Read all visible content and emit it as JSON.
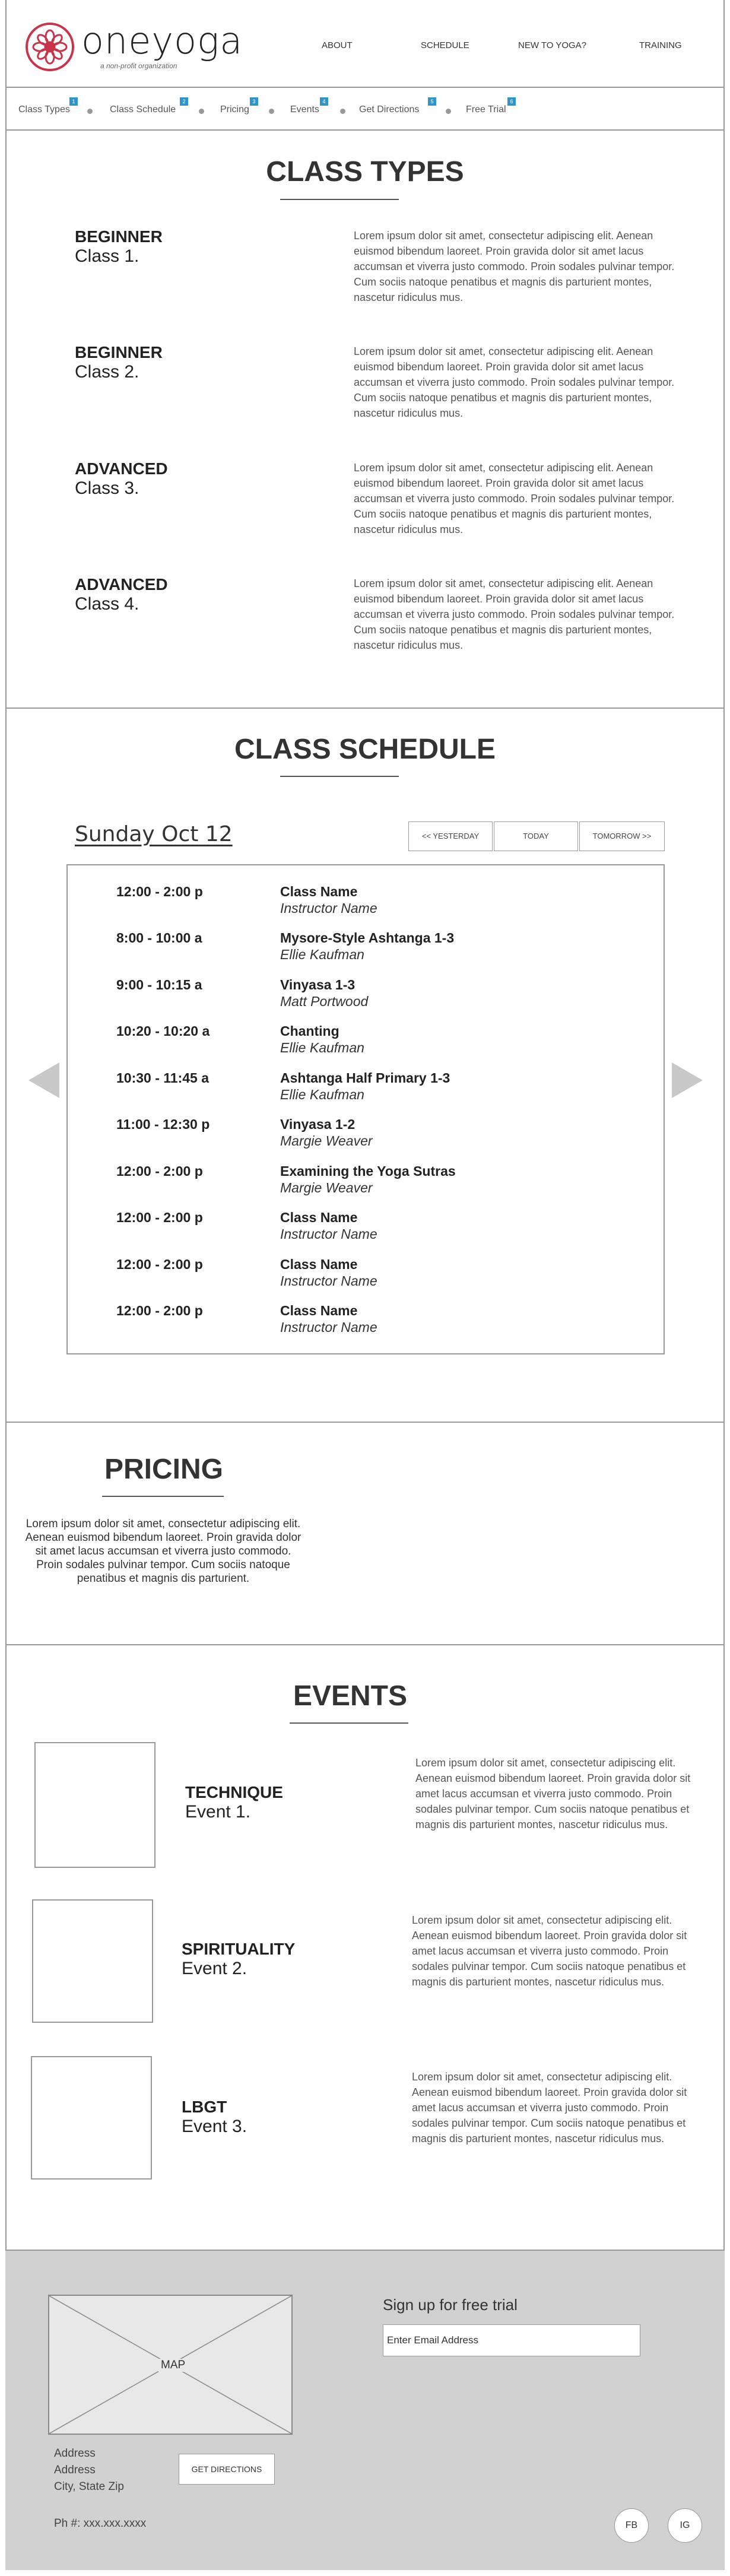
{
  "header": {
    "brand": "oneyoga",
    "tagline": "a non-profit organization",
    "nav": [
      "ABOUT",
      "SCHEDULE",
      "NEW TO YOGA?",
      "TRAINING"
    ],
    "brand_color": "#c8354a"
  },
  "subnav": {
    "items": [
      {
        "label": "Class Types",
        "badge": "1"
      },
      {
        "label": "Class Schedule",
        "badge": "2"
      },
      {
        "label": "Pricing",
        "badge": "3"
      },
      {
        "label": "Events",
        "badge": "4"
      },
      {
        "label": "Get Directions",
        "badge": "5"
      },
      {
        "label": "Free Trial",
        "badge": "6"
      }
    ],
    "badge_color": "#2e94c9"
  },
  "class_types": {
    "title": "CLASS TYPES",
    "items": [
      {
        "level": "BEGINNER",
        "name": "Class 1.",
        "text": "Lorem ipsum dolor sit amet, consectetur adipiscing elit. Aenean euismod bibendum laoreet. Proin gravida dolor sit amet lacus accumsan et viverra justo commodo. Proin sodales pulvinar tempor. Cum sociis natoque penatibus et magnis dis parturient montes, nascetur ridiculus mus."
      },
      {
        "level": "BEGINNER",
        "name": "Class 2.",
        "text": "Lorem ipsum dolor sit amet, consectetur adipiscing elit. Aenean euismod bibendum laoreet. Proin gravida dolor sit amet lacus accumsan et viverra justo commodo. Proin sodales pulvinar tempor. Cum sociis natoque penatibus et magnis dis parturient montes, nascetur ridiculus mus."
      },
      {
        "level": "ADVANCED",
        "name": "Class 3.",
        "text": "Lorem ipsum dolor sit amet, consectetur adipiscing elit. Aenean euismod bibendum laoreet. Proin gravida dolor sit amet lacus accumsan et viverra justo commodo. Proin sodales pulvinar tempor. Cum sociis natoque penatibus et magnis dis parturient montes, nascetur ridiculus mus."
      },
      {
        "level": "ADVANCED",
        "name": "Class 4.",
        "text": "Lorem ipsum dolor sit amet, consectetur adipiscing elit. Aenean euismod bibendum laoreet. Proin gravida dolor sit amet lacus accumsan et viverra justo commodo. Proin sodales pulvinar tempor. Cum sociis natoque penatibus et magnis dis parturient montes, nascetur ridiculus mus."
      }
    ]
  },
  "schedule": {
    "title": "CLASS SCHEDULE",
    "date": "Sunday Oct 12",
    "buttons": {
      "yesterday": "<< YESTERDAY",
      "today": "TODAY",
      "tomorrow": "TOMORROW >>"
    },
    "rows": [
      {
        "time": "12:00 - 2:00 p",
        "class": "Class Name",
        "instructor": "Instructor Name"
      },
      {
        "time": "8:00 - 10:00 a",
        "class": "Mysore-Style Ashtanga 1-3",
        "instructor": "Ellie Kaufman"
      },
      {
        "time": "9:00 - 10:15 a",
        "class": "Vinyasa 1-3",
        "instructor": "Matt Portwood"
      },
      {
        "time": "10:20 - 10:20 a",
        "class": "Chanting",
        "instructor": "Ellie Kaufman"
      },
      {
        "time": "10:30 - 11:45 a",
        "class": "Ashtanga Half Primary 1-3",
        "instructor": "Ellie Kaufman"
      },
      {
        "time": "11:00 - 12:30 p",
        "class": "Vinyasa 1-2",
        "instructor": "Margie Weaver"
      },
      {
        "time": "12:00 - 2:00 p",
        "class": "Examining the Yoga Sutras",
        "instructor": "Margie Weaver"
      },
      {
        "time": "12:00 - 2:00 p",
        "class": "Class Name",
        "instructor": "Instructor Name"
      },
      {
        "time": "12:00 - 2:00 p",
        "class": "Class Name",
        "instructor": "Instructor Name"
      },
      {
        "time": "12:00 - 2:00 p",
        "class": "Class Name",
        "instructor": "Instructor Name"
      }
    ]
  },
  "pricing": {
    "title": "PRICING",
    "text": "Lorem ipsum dolor sit amet, consectetur adipiscing elit. Aenean euismod bibendum laoreet. Proin gravida dolor sit amet lacus accumsan et viverra justo commodo. Proin sodales pulvinar tempor. Cum sociis natoque penatibus et magnis dis parturient."
  },
  "events": {
    "title": "EVENTS",
    "items": [
      {
        "category": "TECHNIQUE",
        "name": "Event 1.",
        "text": "Lorem ipsum dolor sit amet, consectetur adipiscing elit. Aenean euismod bibendum laoreet. Proin gravida dolor sit amet lacus accumsan et viverra justo commodo. Proin sodales pulvinar tempor. Cum sociis natoque penatibus et magnis dis parturient montes, nascetur ridiculus mus."
      },
      {
        "category": "SPIRITUALITY",
        "name": "Event 2.",
        "text": "Lorem ipsum dolor sit amet, consectetur adipiscing elit. Aenean euismod bibendum laoreet. Proin gravida dolor sit amet lacus accumsan et viverra justo commodo. Proin sodales pulvinar tempor. Cum sociis natoque penatibus et magnis dis parturient montes, nascetur ridiculus mus."
      },
      {
        "category": "LBGT",
        "name": "Event 3.",
        "text": "Lorem ipsum dolor sit amet, consectetur adipiscing elit. Aenean euismod bibendum laoreet. Proin gravida dolor sit amet lacus accumsan et viverra justo commodo. Proin sodales pulvinar tempor. Cum sociis natoque penatibus et magnis dis parturient montes, nascetur ridiculus mus."
      }
    ]
  },
  "footer": {
    "map_label": "MAP",
    "address": [
      "Address",
      "Address",
      "City, State Zip"
    ],
    "directions_button": "GET DIRECTIONS",
    "phone": "Ph #: xxx.xxx.xxxx",
    "signup_label": "Sign up for free trial",
    "email_value": "Enter Email Address",
    "social": [
      "FB",
      "IG"
    ],
    "background": "#d1d1d1"
  }
}
